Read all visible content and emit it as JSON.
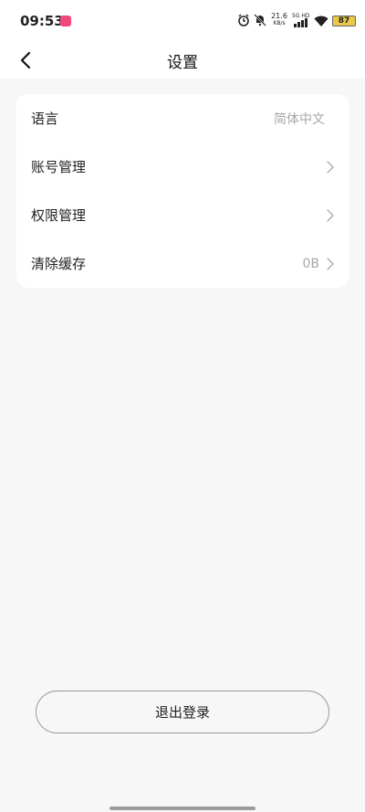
{
  "status_bar": {
    "time": "09:53",
    "net_speed_value": "21.6",
    "net_speed_unit": "KB/s",
    "signal_label": "5G HD",
    "battery": "87"
  },
  "nav": {
    "title": "设置"
  },
  "settings": {
    "items": [
      {
        "label": "语言",
        "value": "简体中文",
        "has_chevron": false
      },
      {
        "label": "账号管理",
        "value": "",
        "has_chevron": true
      },
      {
        "label": "权限管理",
        "value": "",
        "has_chevron": true
      },
      {
        "label": "清除缓存",
        "value": "0B",
        "has_chevron": true
      }
    ]
  },
  "logout": {
    "label": "退出登录"
  },
  "colors": {
    "background": "#f7f7f7",
    "card": "#ffffff",
    "secondary_text": "#a6a6a6",
    "battery": "#e9c84a"
  }
}
